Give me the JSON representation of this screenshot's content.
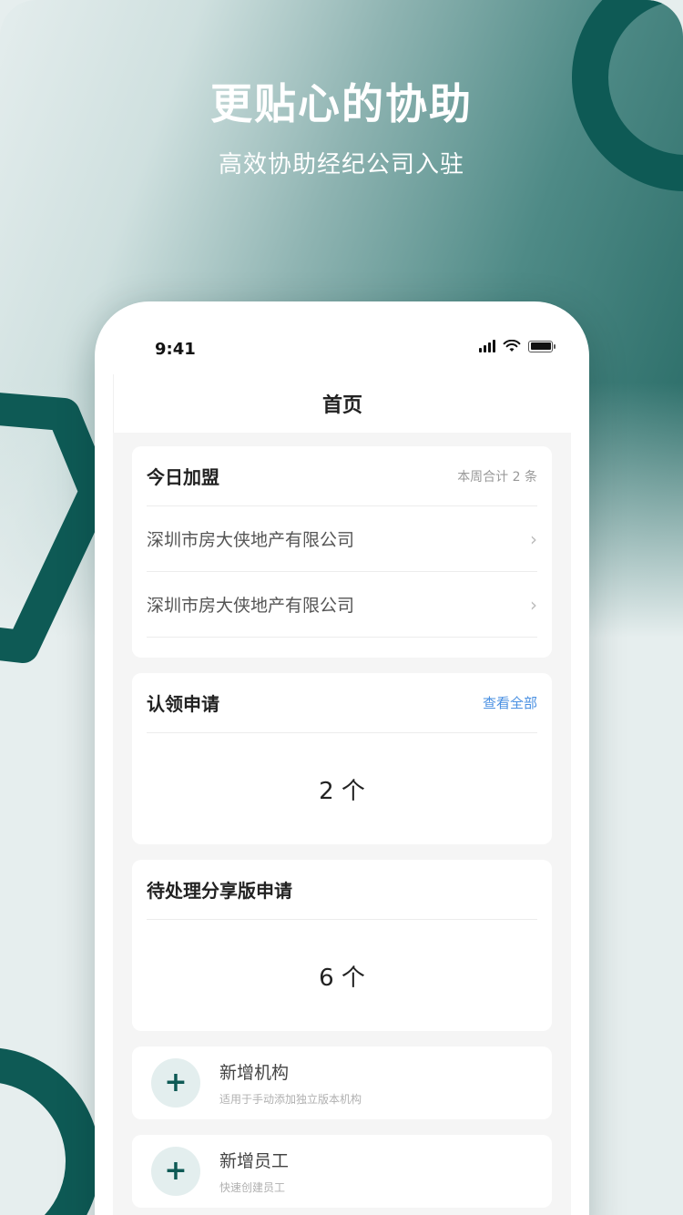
{
  "promo": {
    "title": "更贴心的协助",
    "subtitle": "高效协助经纪公司入驻"
  },
  "status_bar": {
    "time": "9:41"
  },
  "nav": {
    "title": "首页"
  },
  "today_join": {
    "title": "今日加盟",
    "meta": "本周合计 2 条",
    "items": [
      {
        "label": "深圳市房大侠地产有限公司"
      },
      {
        "label": "深圳市房大侠地产有限公司"
      }
    ]
  },
  "claim_requests": {
    "title": "认领申请",
    "link": "查看全部",
    "count": "2 个"
  },
  "pending_share": {
    "title": "待处理分享版申请",
    "count": "6 个"
  },
  "actions": [
    {
      "title": "新增机构",
      "desc": "适用于手动添加独立版本机构",
      "icon": "plus-icon"
    },
    {
      "title": "新增员工",
      "desc": "快速创建员工",
      "icon": "plus-icon"
    }
  ],
  "colors": {
    "brand": "#0e5a55",
    "link": "#4a90e2"
  }
}
